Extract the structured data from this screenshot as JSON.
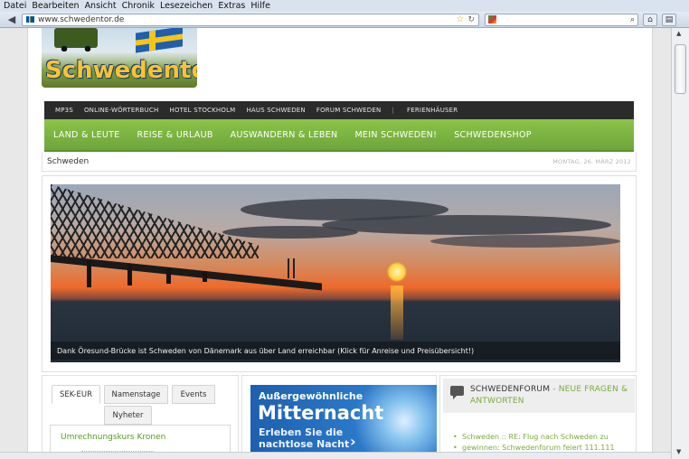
{
  "browser": {
    "menu": [
      "Datei",
      "Bearbeiten",
      "Ansicht",
      "Chronik",
      "Lesezeichen",
      "Extras",
      "Hilfe"
    ],
    "url": "www.schwedentor.de",
    "back_icon": "arrow-left-icon",
    "reload_icon": "reload-icon"
  },
  "site": {
    "logo_text": "Schwedentor",
    "topnav": [
      "MP3S",
      "ONLINE-WÖRTERBUCH",
      "HOTEL STOCKHOLM",
      "HAUS SCHWEDEN",
      "FORUM SCHWEDEN",
      "|",
      "FERIENHÄUSER"
    ],
    "mainnav": [
      "LAND & LEUTE",
      "REISE & URLAUB",
      "AUSWANDERN & LEBEN",
      "MEIN SCHWEDEN!",
      "SCHWEDENSHOP"
    ],
    "breadcrumb": "Schweden",
    "date": "MONTAG, 26. MÄRZ 2012",
    "hero_caption": "Dank Öresund-Brücke ist Schweden von Dänemark aus über Land erreichbar (Klick für Anreise und Preisübersicht!)",
    "tabs": [
      "SEK-EUR",
      "Namenstage",
      "Events",
      "Nyheter"
    ],
    "active_tab": "SEK-EUR",
    "panel_heading": "Umrechnungskurs Kronen",
    "ad": {
      "line1": "Außergewöhnliche",
      "line2": "Mitternacht",
      "line3": "Erleben Sie die",
      "line4": "nachtlose Nacht"
    },
    "forum": {
      "title": "SCHWEDENFORUM",
      "title_suffix": " - NEUE FRAGEN &",
      "title_line2": "ANTWORTEN",
      "items": [
        "Schweden :: RE: Flug nach Schweden zu",
        "gewinnen: Schwedenforum feiert 111.111"
      ]
    }
  },
  "colors": {
    "accent_green": "#7cab3a",
    "nav_green": "#8bc34a",
    "topnav_dark": "#2b2b2b"
  }
}
